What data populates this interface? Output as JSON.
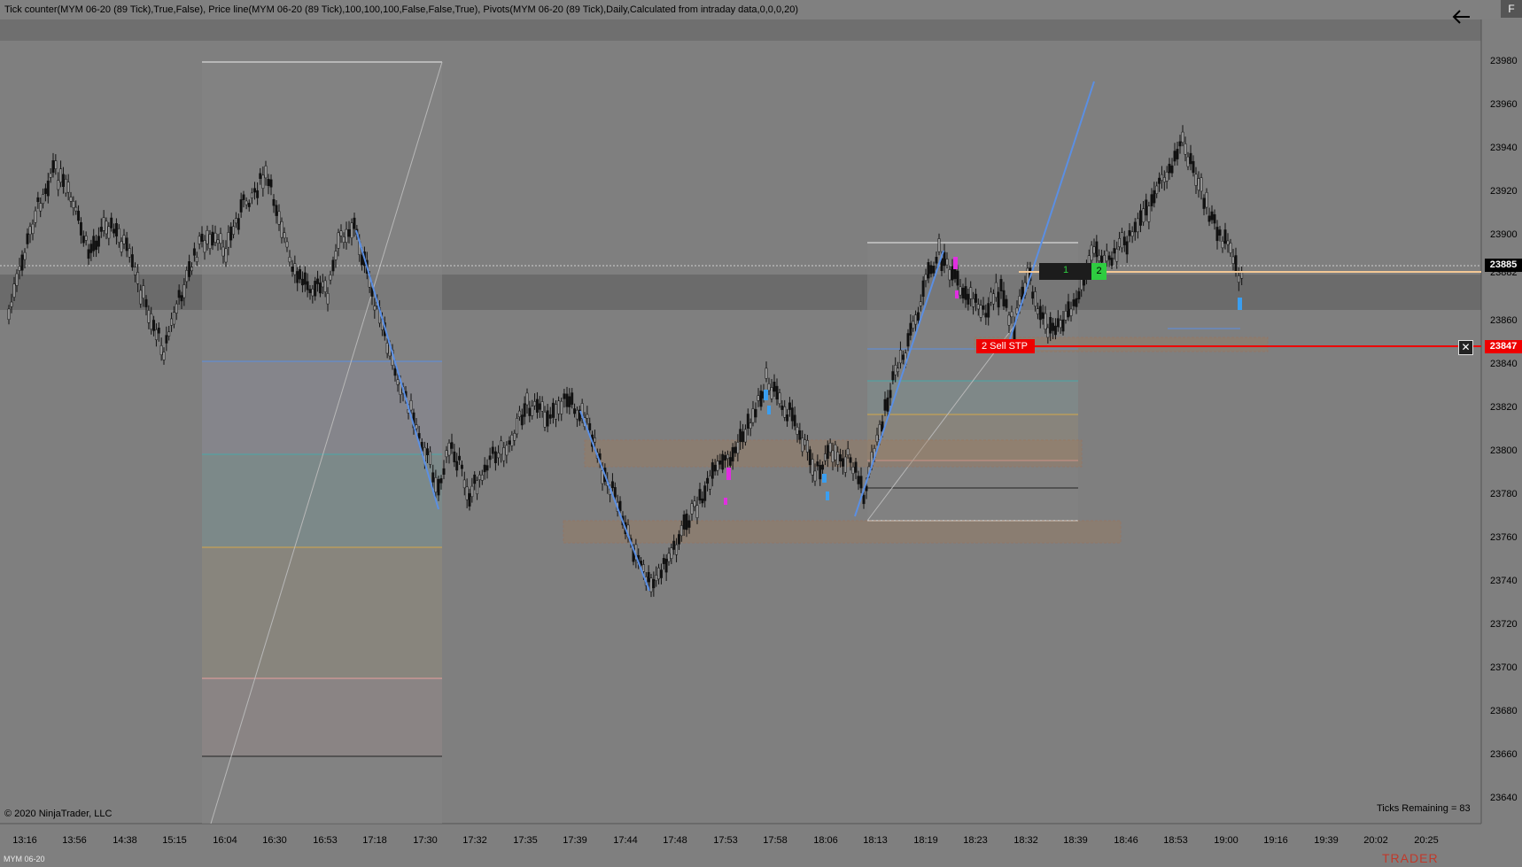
{
  "header": {
    "indicators_text": "Tick counter(MYM 06-20 (89 Tick),True,False), Price line(MYM 06-20 (89 Tick),100,100,100,False,False,True), Pivots(MYM 06-20 (89 Tick),Daily,Calculated from intraday data,0,0,0,20)",
    "f_button": "F",
    "back_icon": "arrow-left-icon"
  },
  "price_axis": {
    "labels": [
      "23980",
      "23960",
      "23940",
      "23920",
      "23900",
      "23882",
      "23860",
      "23840",
      "23820",
      "23800",
      "23780",
      "23760",
      "23740",
      "23720",
      "23700",
      "23680",
      "23660",
      "23640"
    ]
  },
  "time_axis": {
    "labels": [
      "13:16",
      "13:56",
      "14:38",
      "15:15",
      "16:04",
      "16:30",
      "16:53",
      "17:18",
      "17:30",
      "17:32",
      "17:35",
      "17:39",
      "17:44",
      "17:48",
      "17:53",
      "17:58",
      "18:06",
      "18:13",
      "18:19",
      "18:23",
      "18:32",
      "18:39",
      "18:46",
      "18:53",
      "19:00",
      "19:16",
      "19:39",
      "20:02",
      "20:25"
    ]
  },
  "last_price": "23885",
  "stop_order": {
    "price": "23847",
    "label": "2  Sell STP",
    "quantity": "2",
    "close_icon": "close-x-icon"
  },
  "position": {
    "quantity_left": "1",
    "quantity_right": "2"
  },
  "footer": {
    "copyright": "© 2020 NinjaTrader, LLC",
    "ticks_remaining": "Ticks Remaining = 83",
    "instrument": "MYM 06-20",
    "brand": "TRADER"
  },
  "colors": {
    "background": "#7f7f7f",
    "band": "#6e6e6e",
    "pivot_blue": "#5b8fe3",
    "stop_red": "#ee0000",
    "long_green": "#2ecc40",
    "zone_orange": "#b0683c"
  }
}
